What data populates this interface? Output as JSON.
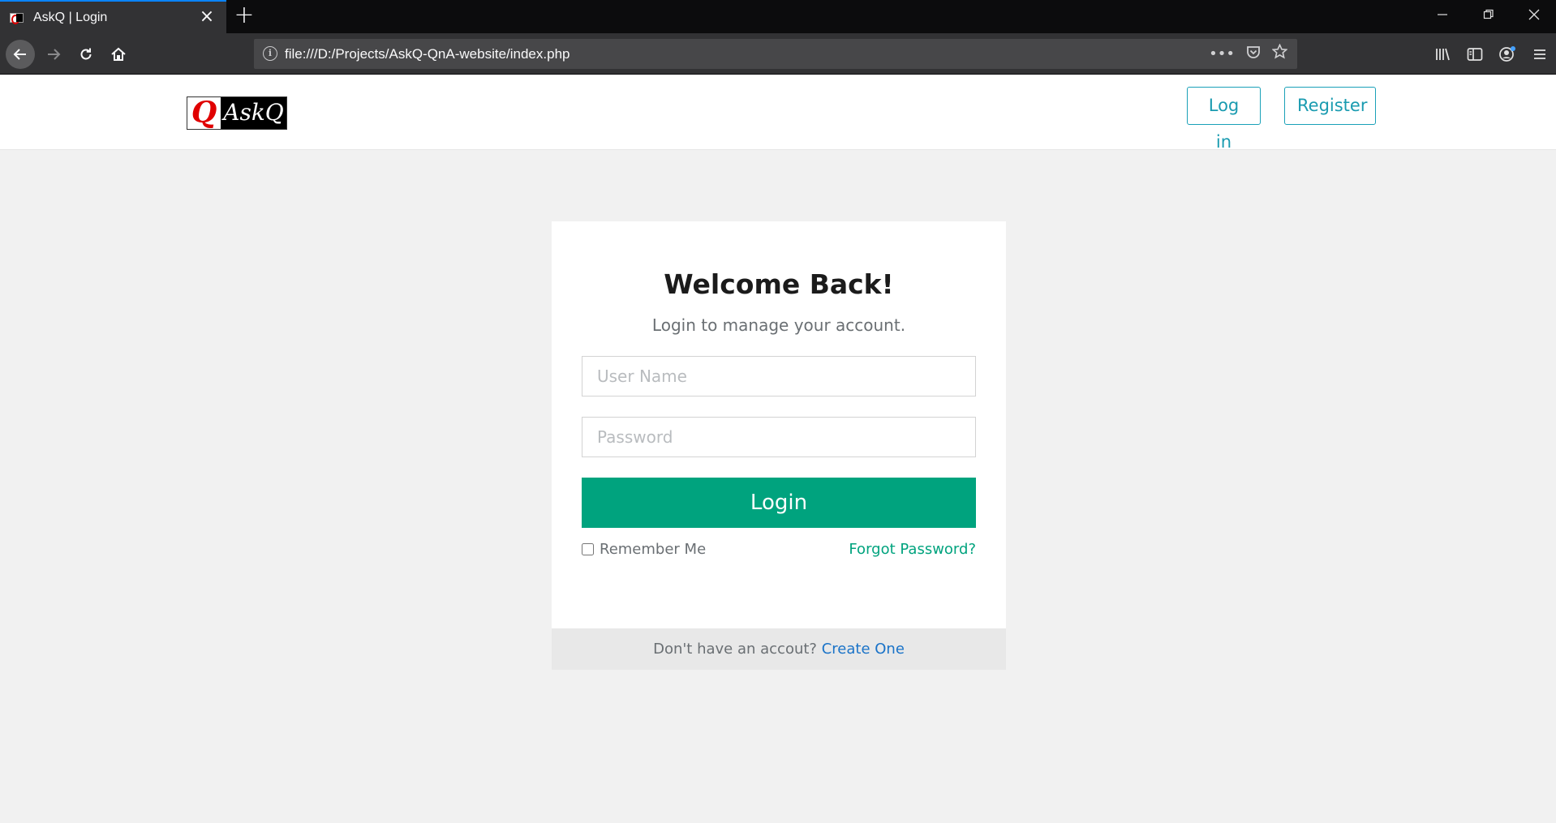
{
  "browser": {
    "tab_title": "AskQ | Login",
    "url": "file:///D:/Projects/AskQ-QnA-website/index.php",
    "accent_color": "#0a84ff"
  },
  "site": {
    "logo": {
      "q": "Q",
      "text": "AskQ"
    },
    "header": {
      "login_label": "Log in",
      "register_label": "Register"
    }
  },
  "login_card": {
    "title": "Welcome Back!",
    "subtitle": "Login to manage your account.",
    "username_placeholder": "User Name",
    "password_placeholder": "Password",
    "submit_label": "Login",
    "remember_label": "Remember Me",
    "remember_checked": false,
    "forgot_label": "Forgot Password?",
    "footer_question": "Don't have an accout?",
    "footer_link": "Create One"
  },
  "colors": {
    "primary": "#00a37e",
    "header_button": "#1a9bb0",
    "link": "#1a73c8"
  }
}
